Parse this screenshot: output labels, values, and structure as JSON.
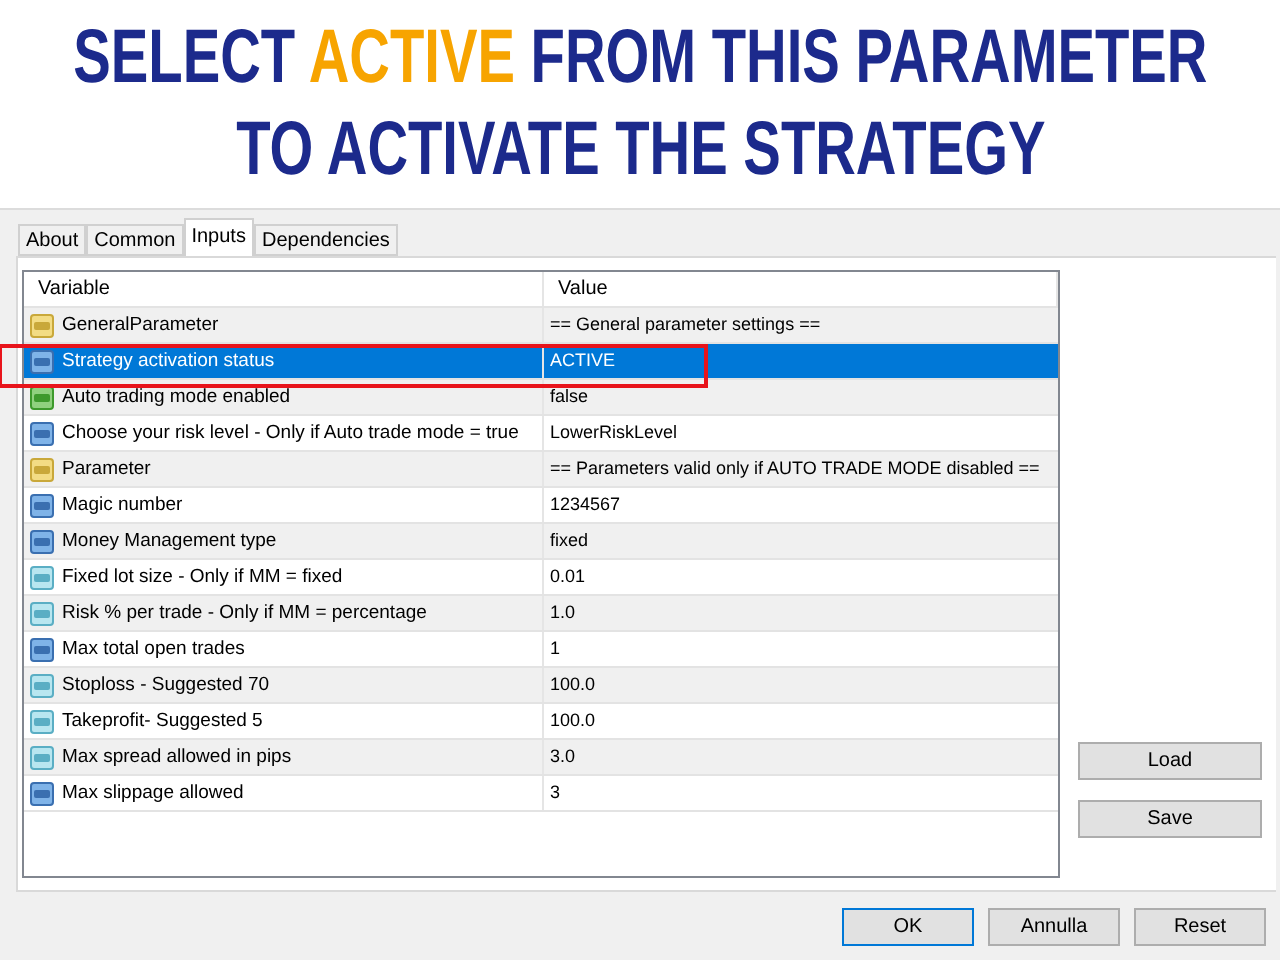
{
  "headline": [
    [
      {
        "text": "SELECT ",
        "accent": false
      },
      {
        "text": "ACTIVE",
        "accent": true
      },
      {
        "text": " FROM THIS PARAMETER",
        "accent": false
      }
    ],
    [
      {
        "text": "TO ACTIVATE THE STRATEGY",
        "accent": false
      }
    ]
  ],
  "tabs": [
    {
      "label": "About",
      "selected": false
    },
    {
      "label": "Common",
      "selected": false
    },
    {
      "label": "Inputs",
      "selected": true
    },
    {
      "label": "Dependencies",
      "selected": false
    }
  ],
  "table": {
    "columns": [
      "Variable",
      "Value"
    ],
    "rows": [
      {
        "kind": "text",
        "variable": "GeneralParameter",
        "value": "== General parameter settings ==",
        "selected": false
      },
      {
        "kind": "integer",
        "variable": "Strategy activation status",
        "value": "ACTIVE",
        "selected": true
      },
      {
        "kind": "bool",
        "variable": "Auto trading mode enabled",
        "value": "false",
        "selected": false
      },
      {
        "kind": "integer",
        "variable": "Choose your risk level - Only if Auto trade mode = true",
        "value": "LowerRiskLevel",
        "selected": false
      },
      {
        "kind": "text",
        "variable": "Parameter",
        "value": "== Parameters valid only if AUTO TRADE MODE disabled ==",
        "selected": false
      },
      {
        "kind": "integer",
        "variable": "Magic number",
        "value": "1234567",
        "selected": false
      },
      {
        "kind": "integer",
        "variable": "Money Management type",
        "value": "fixed",
        "selected": false
      },
      {
        "kind": "double",
        "variable": "Fixed lot size - Only if MM = fixed",
        "value": "0.01",
        "selected": false
      },
      {
        "kind": "double",
        "variable": "Risk % per trade - Only if MM = percentage",
        "value": "1.0",
        "selected": false
      },
      {
        "kind": "integer",
        "variable": "Max total open trades",
        "value": "1",
        "selected": false
      },
      {
        "kind": "double",
        "variable": "Stoploss - Suggested 70",
        "value": "100.0",
        "selected": false
      },
      {
        "kind": "double",
        "variable": "Takeprofit- Suggested 5",
        "value": "100.0",
        "selected": false
      },
      {
        "kind": "double",
        "variable": "Max spread allowed in pips",
        "value": "3.0",
        "selected": false
      },
      {
        "kind": "integer",
        "variable": "Max slippage allowed",
        "value": "3",
        "selected": false
      }
    ]
  },
  "side_buttons": [
    "Load",
    "Save"
  ],
  "buttons": [
    {
      "label": "OK",
      "default": true
    },
    {
      "label": "Annulla",
      "default": false
    },
    {
      "label": "Reset",
      "default": false
    }
  ]
}
